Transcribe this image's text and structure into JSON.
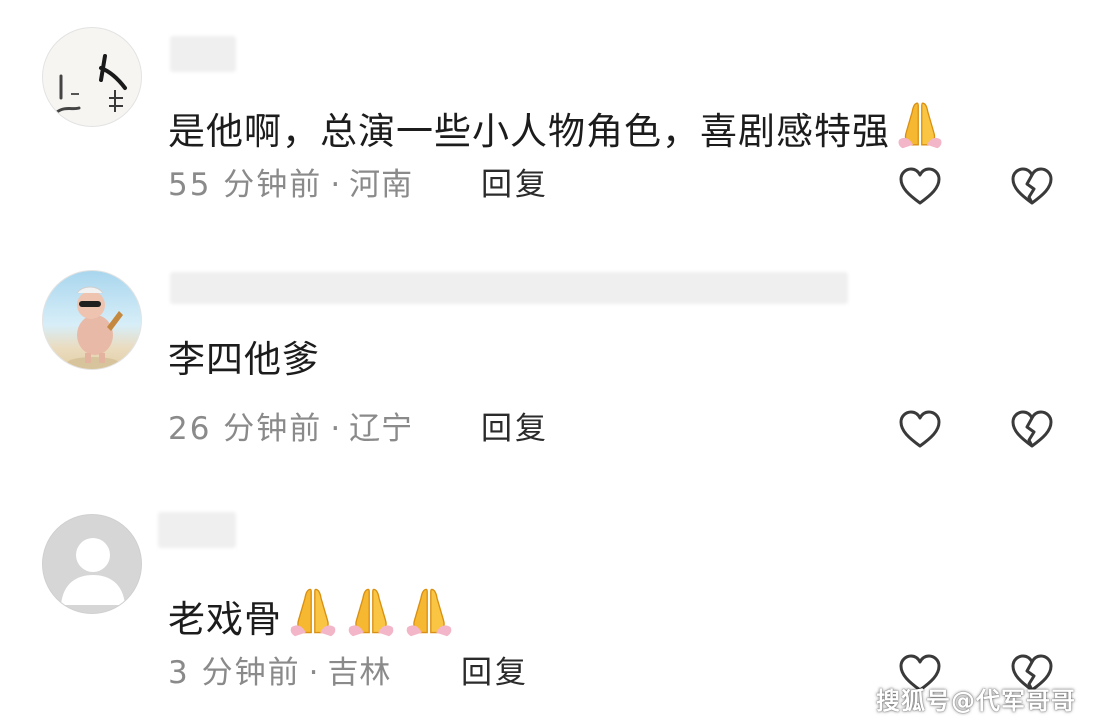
{
  "comments": [
    {
      "text": "是他啊，总演一些小人物角色，喜剧感特强",
      "emoji_count": 1,
      "time": "55 分钟前",
      "separator": "·",
      "location": "河南",
      "reply_label": "回复",
      "avatar": "calligraphy-avatar"
    },
    {
      "text": "李四他爹",
      "emoji_count": 0,
      "time": "26 分钟前",
      "separator": "·",
      "location": "辽宁",
      "reply_label": "回复",
      "avatar": "cartoon-character-avatar"
    },
    {
      "text": "老戏骨",
      "emoji_count": 3,
      "time": "3 分钟前",
      "separator": "·",
      "location": "吉林",
      "reply_label": "回复",
      "avatar": "default-user-avatar"
    }
  ],
  "icons": {
    "like": "heart-outline-icon",
    "dislike": "broken-heart-icon",
    "emoji": "folded-hands-emoji"
  },
  "colors": {
    "text": "#1c1c1c",
    "meta": "#8a8a8a",
    "icon": "#3a3a3a",
    "emoji": "#f6b830"
  },
  "watermark": "搜狐号@代军哥哥"
}
